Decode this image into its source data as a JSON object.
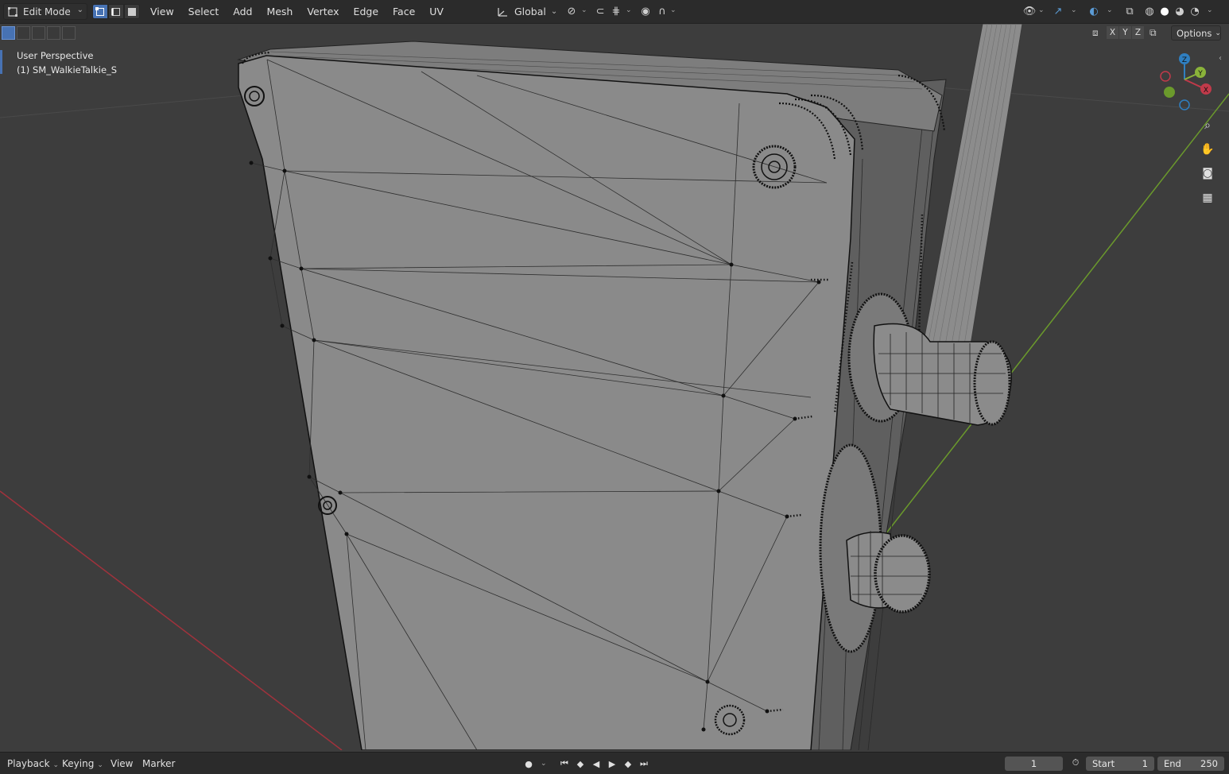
{
  "header": {
    "mode": "Edit Mode",
    "menus": [
      "View",
      "Select",
      "Add",
      "Mesh",
      "Vertex",
      "Edge",
      "Face",
      "UV"
    ],
    "orientation": "Global",
    "options_label": "Options",
    "axis_buttons": [
      "X",
      "Y",
      "Z"
    ]
  },
  "viewport": {
    "perspective_label": "User Perspective",
    "object_label": "(1) SM_WalkieTalkie_S",
    "gizmo_axes": {
      "x": "X",
      "y": "Y",
      "z": "Z"
    },
    "colors": {
      "background": "#3d3d3d",
      "mesh_face": "#8a8a8a",
      "x_axis": "#a0323c",
      "y_axis": "#6b9a2c",
      "selection_accent": "#4772b3"
    }
  },
  "footer": {
    "menus": [
      "Playback",
      "Keying",
      "View",
      "Marker"
    ],
    "current_frame": "1",
    "start_label": "Start",
    "start_value": "1",
    "end_label": "End",
    "end_value": "250"
  }
}
